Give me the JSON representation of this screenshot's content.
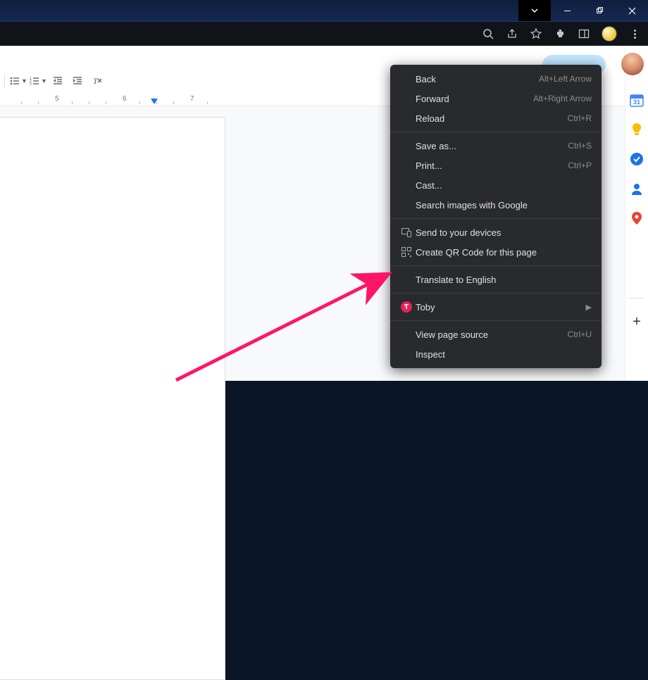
{
  "window_controls": {
    "dropdown": "⌄",
    "minimize": "—",
    "maximize": "❐",
    "close": "✕"
  },
  "chrome_icons": {
    "search": "search-icon",
    "share": "share-icon",
    "star": "star-icon",
    "ext": "extension-icon",
    "panel": "side-panel-icon",
    "menu": "kebab-menu"
  },
  "docs_toolbar": {
    "bullet": "bulleted-list",
    "number": "numbered-list",
    "dedent": "decrease-indent",
    "indent": "increase-indent",
    "clear": "clear-formatting"
  },
  "ruler": {
    "marks": [
      "5",
      "6",
      "7"
    ]
  },
  "context_menu": {
    "groups": [
      [
        {
          "label": "Back",
          "shortcut": "Alt+Left Arrow",
          "icon": ""
        },
        {
          "label": "Forward",
          "shortcut": "Alt+Right Arrow",
          "icon": ""
        },
        {
          "label": "Reload",
          "shortcut": "Ctrl+R",
          "icon": ""
        }
      ],
      [
        {
          "label": "Save as...",
          "shortcut": "Ctrl+S",
          "icon": ""
        },
        {
          "label": "Print...",
          "shortcut": "Ctrl+P",
          "icon": ""
        },
        {
          "label": "Cast...",
          "shortcut": "",
          "icon": ""
        },
        {
          "label": "Search images with Google",
          "shortcut": "",
          "icon": ""
        }
      ],
      [
        {
          "label": "Send to your devices",
          "shortcut": "",
          "icon": "devices"
        },
        {
          "label": "Create QR Code for this page",
          "shortcut": "",
          "icon": "qr"
        }
      ],
      [
        {
          "label": "Translate to English",
          "shortcut": "",
          "icon": ""
        }
      ],
      [
        {
          "label": "Toby",
          "shortcut": "",
          "icon": "toby",
          "submenu": true
        }
      ],
      [
        {
          "label": "View page source",
          "shortcut": "Ctrl+U",
          "icon": ""
        },
        {
          "label": "Inspect",
          "shortcut": "",
          "icon": ""
        }
      ]
    ]
  },
  "sidebar_apps": [
    "calendar",
    "keep",
    "tasks",
    "contacts",
    "maps"
  ],
  "colors": {
    "accent": "#1a73e8",
    "menu_bg": "#292a2d",
    "arrow": "#ff1566"
  }
}
